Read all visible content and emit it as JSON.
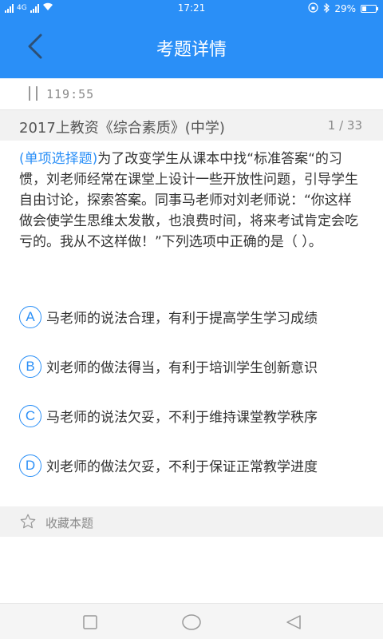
{
  "status_bar": {
    "network": "4G",
    "time": "17:21",
    "battery": "29%",
    "battery_level": 0.29
  },
  "header": {
    "title": "考题详情"
  },
  "timer": {
    "value": "119:55"
  },
  "exam": {
    "title": "2017上教资《综合素质》(中学)",
    "progress": "1 / 33"
  },
  "question": {
    "type_label": "(单项选择题)",
    "text": "为了改变学生从课本中找“标准答案“的习惯，刘老师经常在课堂上设计一些开放性问题，引导学生自由讨论，探索答案。同事马老师对刘老师说：“你这样做会使学生思维太发散，也浪费时间，将来考试肯定会吃亏的。我从不这样做！”下列选项中正确的是（    ）。"
  },
  "options": [
    {
      "letter": "A",
      "text": "马老师的说法合理，有利于提高学生学习成绩"
    },
    {
      "letter": "B",
      "text": "刘老师的做法得当，有利于培训学生创新意识"
    },
    {
      "letter": "C",
      "text": "马老师的说法欠妥，不利于维持课堂教学秩序"
    },
    {
      "letter": "D",
      "text": "刘老师的做法欠妥，不利于保证正常教学进度"
    }
  ],
  "favorite": {
    "label": "收藏本题"
  },
  "colors": {
    "primary": "#2a8ff7",
    "text": "#333333",
    "muted": "#8a8a8a"
  }
}
